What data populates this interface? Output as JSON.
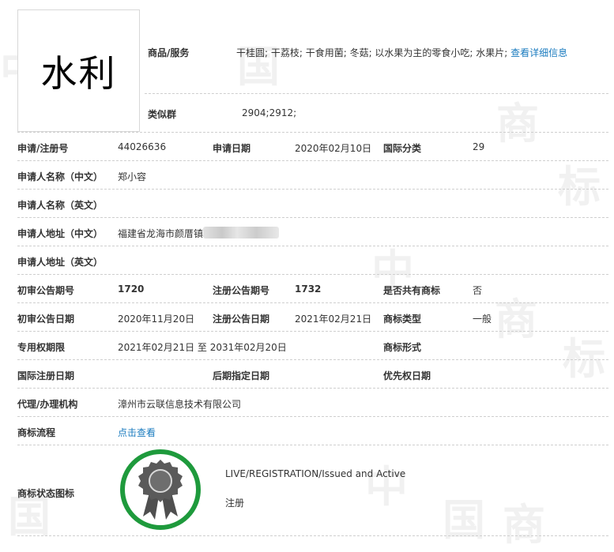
{
  "trademark": {
    "image_text": "水利"
  },
  "goods": {
    "label": "商品/服务",
    "value": "干桂圆; 干荔枝; 干食用菌; 冬菇; 以水果为主的零食小吃; 水果片;",
    "detail_link": "查看详细信息"
  },
  "similar_group": {
    "label": "类似群",
    "value": "2904;2912;"
  },
  "rows": {
    "reg_no_label": "申请/注册号",
    "reg_no": "44026636",
    "apply_date_label": "申请日期",
    "apply_date": "2020年02月10日",
    "intl_class_label": "国际分类",
    "intl_class": "29",
    "applicant_cn_label": "申请人名称（中文）",
    "applicant_cn": "郑小容",
    "applicant_en_label": "申请人名称（英文）",
    "address_cn_label": "申请人地址（中文）",
    "address_cn": "福建省龙海市颜厝镇",
    "address_en_label": "申请人地址（英文）",
    "prelim_issue_label": "初审公告期号",
    "prelim_issue": "1720",
    "reg_issue_label": "注册公告期号",
    "reg_issue": "1732",
    "shared_label": "是否共有商标",
    "shared": "否",
    "prelim_date_label": "初审公告日期",
    "prelim_date": "2020年11月20日",
    "reg_date_label": "注册公告日期",
    "reg_date": "2021年02月21日",
    "tm_type_label": "商标类型",
    "tm_type": "一般",
    "exclusive_label": "专用权期限",
    "exclusive": "2021年02月21日 至 2031年02月20日",
    "tm_form_label": "商标形式",
    "intl_reg_date_label": "国际注册日期",
    "later_date_label": "后期指定日期",
    "priority_date_label": "优先权日期",
    "agent_label": "代理/办理机构",
    "agent": "漳州市云联信息技术有限公司",
    "process_label": "商标流程",
    "process_link": "点击查看",
    "status_icon_label": "商标状态图标",
    "status_en": "LIVE/REGISTRATION/Issued and Active",
    "status_cn": "注册"
  },
  "watermark": [
    "中",
    "国",
    "商",
    "标"
  ],
  "colors": {
    "link": "#1a7bbf",
    "badge_ring": "#1e9a3c",
    "badge_seal": "#555555"
  },
  "icons": {
    "status_badge": "registered-seal-icon"
  }
}
